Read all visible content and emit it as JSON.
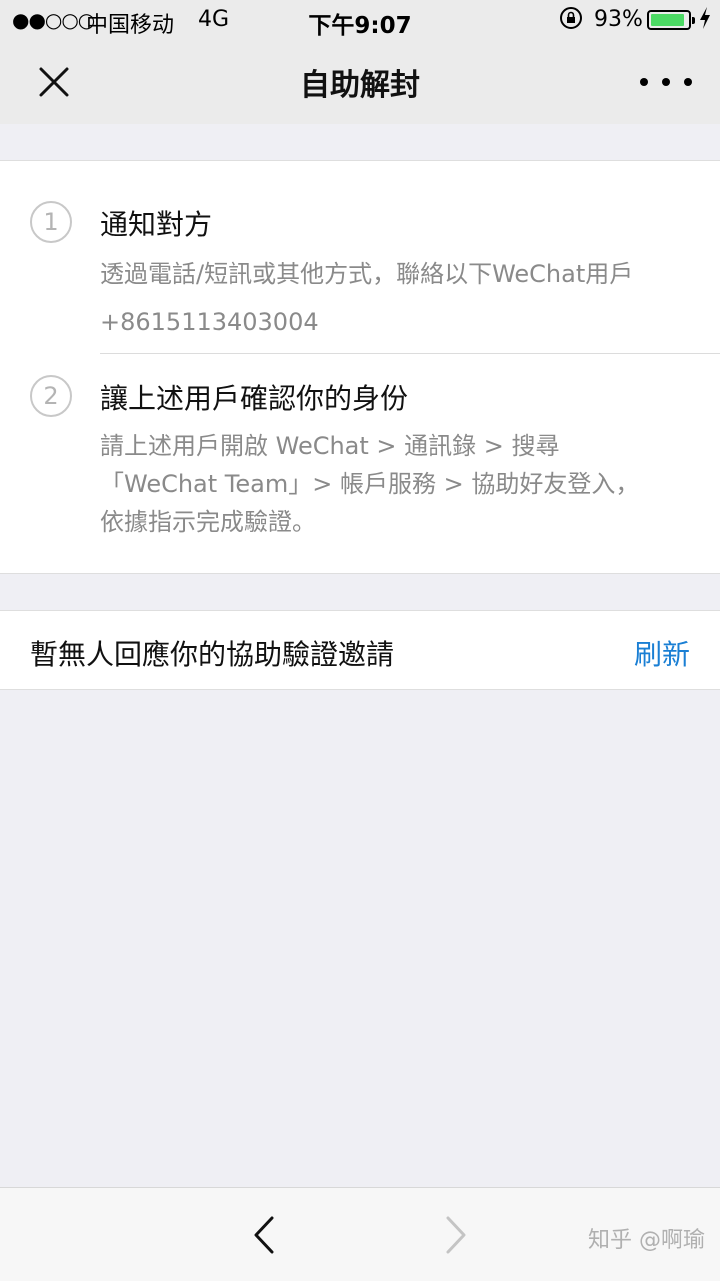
{
  "status_bar": {
    "signal": "●●○○○",
    "carrier": "中国移动",
    "network": "4G",
    "time": "下午9:07",
    "battery_percent": "93%",
    "battery_level": 0.93,
    "battery_color": "#4cd964"
  },
  "nav": {
    "title": "自助解封",
    "close_icon": "close-icon",
    "more_icon": "more-icon"
  },
  "steps": [
    {
      "number": "1",
      "title": "通知對方",
      "lines": [
        "透過電話/短訊或其他方式，聯絡以下WeChat用戶",
        "+8615113403004"
      ]
    },
    {
      "number": "2",
      "title": "讓上述用戶確認你的身份",
      "lines": [
        "請上述用戶開啟 WeChat > 通訊錄 > 搜尋",
        "「WeChat Team」> 帳戶服務 > 協助好友登入，",
        "依據指示完成驗證。"
      ]
    }
  ],
  "pending": {
    "message": "暫無人回應你的協助驗證邀請",
    "refresh_label": "刷新"
  },
  "toolbar": {
    "back_icon": "chevron-left-icon",
    "forward_icon": "chevron-right-icon",
    "watermark": "知乎 @啊瑜"
  },
  "colors": {
    "accent": "#1a7fd4",
    "background": "#efeff4"
  }
}
